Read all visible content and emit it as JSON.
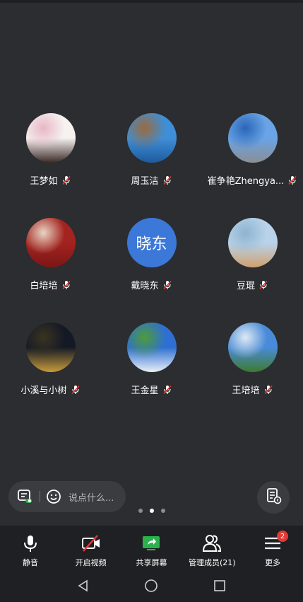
{
  "participants": [
    {
      "name": "王梦如",
      "avatar": "photo",
      "colors": [
        "#f6f2f0",
        "#e8b7c6",
        "#3b2a28"
      ]
    },
    {
      "name": "周玉洁",
      "avatar": "photo",
      "colors": [
        "#3f8ed8",
        "#9a6b3c",
        "#1e5b9c"
      ]
    },
    {
      "name": "崔争艳Zhengya...",
      "avatar": "photo",
      "colors": [
        "#6aa4e6",
        "#2a66b8",
        "#8a8f95"
      ]
    },
    {
      "name": "白培培",
      "avatar": "photo",
      "colors": [
        "#a3231f",
        "#e8d5c4",
        "#7a1716"
      ]
    },
    {
      "name": "戴晓东",
      "avatar": "text",
      "avatar_text": "晓东",
      "colors": [
        "#3b78d8"
      ]
    },
    {
      "name": "豆琨",
      "avatar": "photo",
      "colors": [
        "#b8d3ea",
        "#8fb3cf",
        "#d0a070"
      ]
    },
    {
      "name": "小溪与小树",
      "avatar": "photo",
      "colors": [
        "#141a25",
        "#3a3320",
        "#c79b3c"
      ]
    },
    {
      "name": "王金星",
      "avatar": "photo",
      "colors": [
        "#2e6fd1",
        "#4e9b3a",
        "#e9f0f6"
      ]
    },
    {
      "name": "王培培",
      "avatar": "photo",
      "colors": [
        "#4a8bd9",
        "#dfe9f2",
        "#3d7a2f"
      ]
    }
  ],
  "chat": {
    "placeholder": "说点什么..."
  },
  "pager": {
    "pages": 3,
    "active": 1
  },
  "toolbar": {
    "mute": "静音",
    "video": "开启视频",
    "share": "共享屏幕",
    "members": "管理成员(21)",
    "more": "更多",
    "more_badge": "2"
  },
  "colors": {
    "background": "#2b2d30",
    "toolbar": "#1f2023",
    "share_green": "#2bb24c",
    "muted_red": "#e53935"
  }
}
